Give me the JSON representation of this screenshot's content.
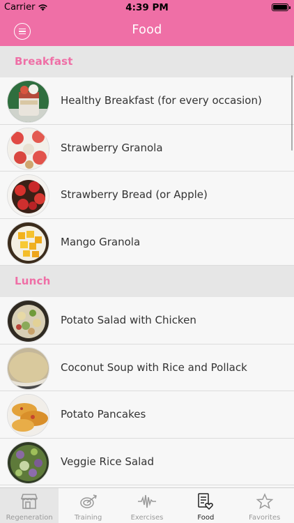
{
  "status_bar": {
    "carrier": "Carrier",
    "time": "4:39 PM"
  },
  "nav": {
    "title": "Food"
  },
  "sections": [
    {
      "title": "Breakfast",
      "items": [
        {
          "label": "Healthy Breakfast (for every occasion)",
          "image": "yogurt-jar-image"
        },
        {
          "label": "Strawberry Granola",
          "image": "strawberry-granola-image"
        },
        {
          "label": "Strawberry Bread (or Apple)",
          "image": "strawberry-bread-image"
        },
        {
          "label": "Mango Granola",
          "image": "mango-granola-image"
        }
      ]
    },
    {
      "title": "Lunch",
      "items": [
        {
          "label": "Potato Salad with Chicken",
          "image": "potato-salad-image"
        },
        {
          "label": "Coconut Soup with Rice and Pollack",
          "image": "coconut-soup-image"
        },
        {
          "label": "Potato Pancakes",
          "image": "potato-pancakes-image"
        },
        {
          "label": "Veggie Rice Salad",
          "image": "veggie-rice-salad-image"
        }
      ]
    }
  ],
  "tabs": [
    {
      "label": "Regeneration",
      "icon": "storefront-icon"
    },
    {
      "label": "Training",
      "icon": "target-arrow-icon"
    },
    {
      "label": "Exercises",
      "icon": "waveform-icon"
    },
    {
      "label": "Food",
      "icon": "menu-heart-icon",
      "active": true
    },
    {
      "label": "Favorites",
      "icon": "star-icon"
    }
  ],
  "colors": {
    "accent": "#ef6fa6",
    "section_bg": "#e6e6e6",
    "row_bg": "#f7f7f7"
  }
}
